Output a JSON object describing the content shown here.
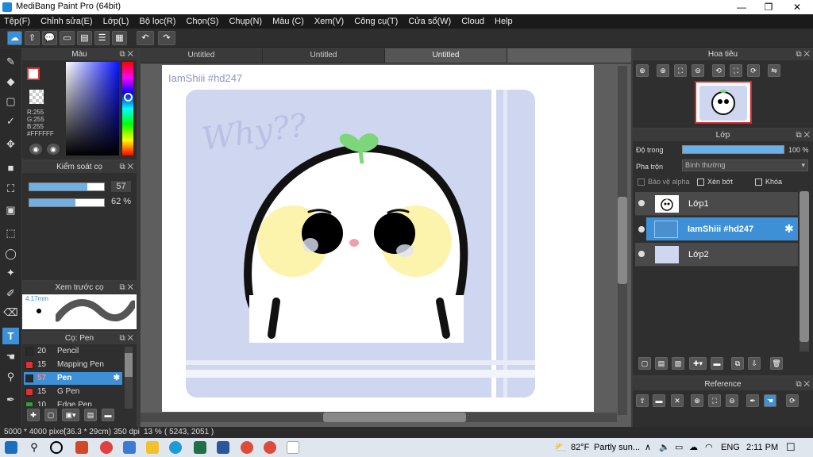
{
  "app": {
    "title": "MediBang Paint Pro (64bit)"
  },
  "window_controls": {
    "minimize": "—",
    "maximize": "❐",
    "close": "✕"
  },
  "menu": [
    "Tệp(F)",
    "Chỉnh sửa(E)",
    "Lớp(L)",
    "Bộ lọc(R)",
    "Chọn(S)",
    "Chụp(N)",
    "Màu (C)",
    "Xem(V)",
    "Công cụ(T)",
    "Cửa sổ(W)",
    "Cloud",
    "Help"
  ],
  "tabs": [
    "Untitled",
    "Untitled",
    "Untitled"
  ],
  "color_panel": {
    "title": "Màu",
    "r": "R:255",
    "g": "G:255",
    "b": "B:255",
    "hex": "#FFFFFF"
  },
  "brush_control": {
    "title": "Kiểm soát cọ",
    "size": "57",
    "opacity": "62 %",
    "size_frac": 0.78,
    "opacity_frac": 0.62
  },
  "brush_preview": {
    "title": "Xem trước cọ",
    "size_label": "4.17mm"
  },
  "brush_list": {
    "title": "Cọ: Pen",
    "items": [
      {
        "size": "20",
        "name": "Pencil",
        "color": "#2a2a2a"
      },
      {
        "size": "15",
        "name": "Mapping Pen",
        "color": "#e03030"
      },
      {
        "size": "57",
        "name": "Pen",
        "color": "#2a2a2a",
        "selected": true
      },
      {
        "size": "15",
        "name": "G Pen",
        "color": "#e03030"
      },
      {
        "size": "10",
        "name": "Edge Pen",
        "color": "#30a030"
      }
    ]
  },
  "canvas": {
    "watermark": "IamShiii #hd247",
    "doodle_text": "Why??"
  },
  "navigator": {
    "title": "Hoa tiêu"
  },
  "layers": {
    "title": "Lớp",
    "opacity_label": "Độ trong",
    "opacity_value": "100 %",
    "opacity_frac": 1.0,
    "blend_label": "Pha trộn",
    "blend_value": "Bình thường",
    "protect_alpha": "Bảo vệ alpha",
    "clipping": "Xén bớt",
    "lock": "Khóa",
    "items": [
      {
        "name": "Lớp1",
        "selected": false
      },
      {
        "name": "IamShiii #hd247",
        "selected": true
      },
      {
        "name": "Lớp2",
        "selected": false
      }
    ]
  },
  "reference": {
    "title": "Reference"
  },
  "status": {
    "size": "5000 * 4000 pixel",
    "cm": "(36.3 * 29cm)",
    "dpi": "350 dpi",
    "zoom": "13 %",
    "coords": "( 5243, 2051 )"
  },
  "taskbar": {
    "weather_temp": "82°F",
    "weather_text": "Partly sun...",
    "lang": "ENG",
    "time": "2:11 PM"
  },
  "colors": {
    "accent": "#3d8fd6",
    "canvas_bg": "#cfd6ef",
    "sprout": "#7ed67a"
  }
}
